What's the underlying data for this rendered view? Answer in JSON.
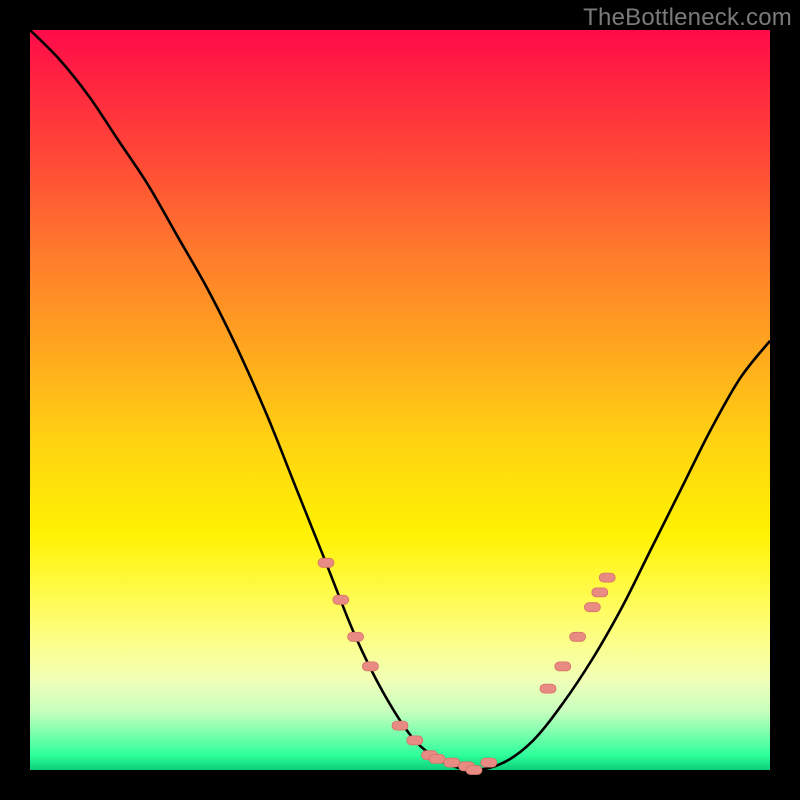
{
  "watermark": "TheBottleneck.com",
  "colors": {
    "background": "#000000",
    "curve": "#000000",
    "marker_fill": "#e88b82",
    "marker_stroke": "#d77168"
  },
  "chart_data": {
    "type": "line",
    "title": "",
    "xlabel": "",
    "ylabel": "",
    "xlim": [
      0,
      100
    ],
    "ylim": [
      0,
      100
    ],
    "grid": false,
    "series": [
      {
        "name": "curve",
        "x": [
          0,
          4,
          8,
          12,
          16,
          20,
          24,
          28,
          32,
          36,
          40,
          44,
          48,
          52,
          56,
          60,
          64,
          68,
          72,
          76,
          80,
          84,
          88,
          92,
          96,
          100
        ],
        "values": [
          100,
          96,
          91,
          85,
          79,
          72,
          65,
          57,
          48,
          38,
          28,
          18,
          10,
          4,
          1,
          0,
          1,
          4,
          9,
          15,
          22,
          30,
          38,
          46,
          53,
          58
        ]
      }
    ],
    "markers": {
      "name": "highlighted-points",
      "x": [
        40,
        42,
        44,
        46,
        50,
        52,
        54,
        55,
        57,
        59,
        60,
        62,
        70,
        72,
        74,
        76,
        77,
        78
      ],
      "values": [
        28,
        23,
        18,
        14,
        6,
        4,
        2,
        1.5,
        1,
        0.5,
        0,
        1,
        11,
        14,
        18,
        22,
        24,
        26
      ]
    }
  }
}
